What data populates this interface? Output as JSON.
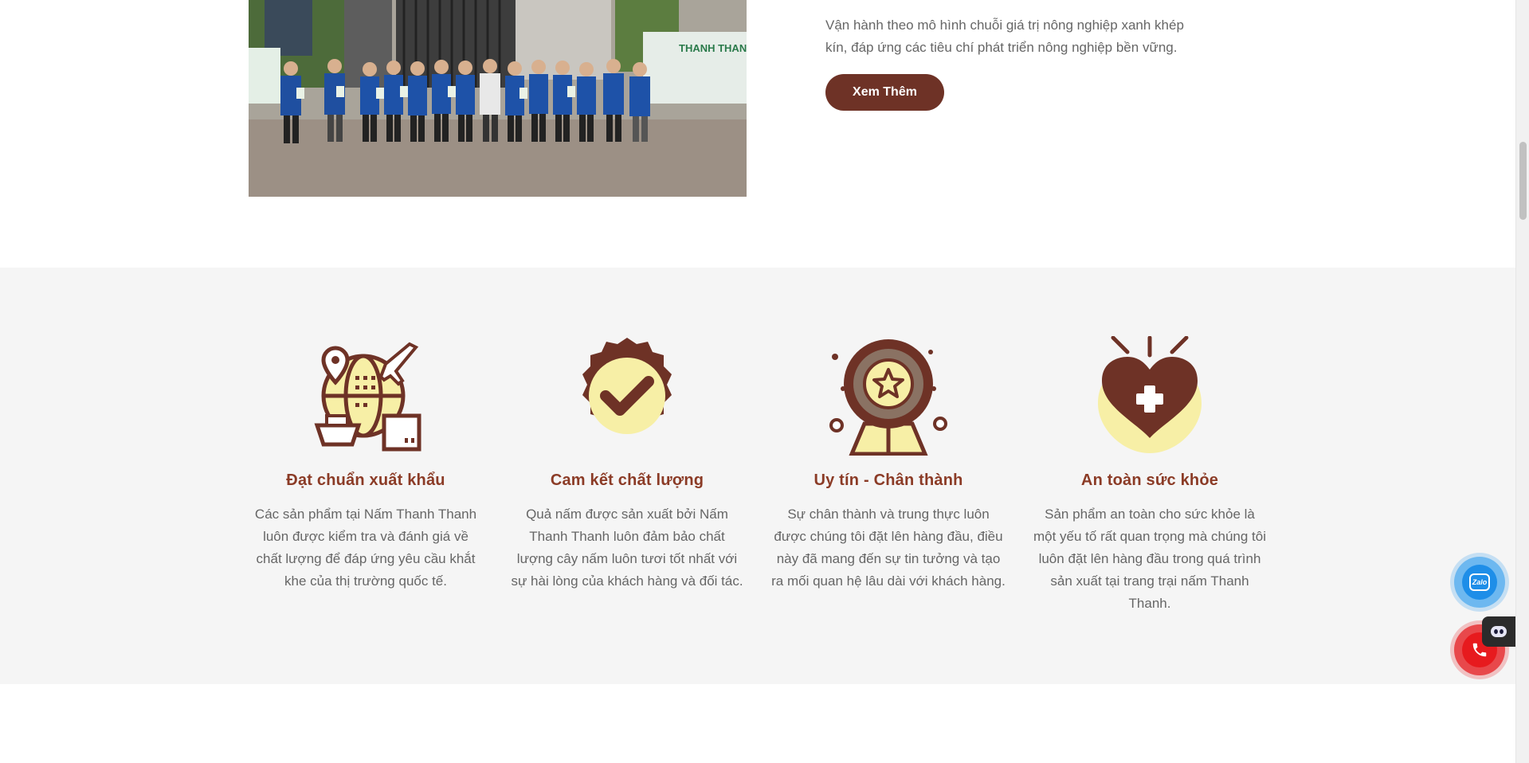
{
  "intro": {
    "text": "Vận hành theo mô hình chuỗi giá trị nông nghiệp xanh khép kín, đáp ứng các tiêu chí phát triển nông nghiệp bền vững.",
    "button_label": "Xem Thêm"
  },
  "hero_photo": {
    "banner_text": "THANH THANH"
  },
  "features": [
    {
      "icon": "globe-export-icon",
      "title": "Đạt chuẩn xuất khẩu",
      "description": "Các sản phẩm tại Nấm Thanh Thanh luôn được kiểm tra và đánh giá về chất lượng để đáp ứng yêu cầu khắt khe của thị trường quốc tế."
    },
    {
      "icon": "check-badge-icon",
      "title": "Cam kết chất lượng",
      "description": "Quả nấm được sản xuất bởi Nấm Thanh Thanh luôn đảm bảo chất lượng cây nấm luôn tươi tốt nhất với sự hài lòng của khách hàng và đối tác."
    },
    {
      "icon": "star-award-icon",
      "title": "Uy tín - Chân thành",
      "description": "Sự chân thành và trung thực luôn được chúng tôi đặt lên hàng đầu, điều này đã mang đến sự tin tưởng và tạo ra mối quan hệ lâu dài với khách hàng."
    },
    {
      "icon": "health-heart-icon",
      "title": "An toàn sức khỏe",
      "description": "Sản phẩm an toàn cho sức khỏe là một yếu tố rất quan trọng mà chúng tôi luôn đặt lên hàng đầu trong quá trình sản xuất tại trang trại nấm Thanh Thanh."
    }
  ],
  "floating": {
    "zalo_label": "Zalo"
  },
  "colors": {
    "brand_brown": "#6e3226",
    "title_brown": "#8b3b26",
    "icon_cream": "#f7efa6",
    "section_bg": "#f5f5f5"
  }
}
